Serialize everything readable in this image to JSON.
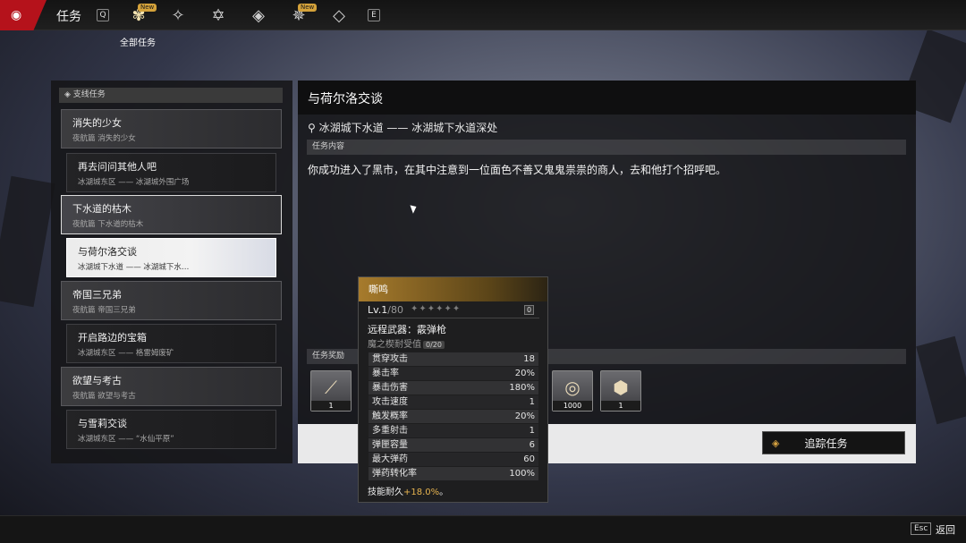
{
  "header": {
    "title": "任务",
    "key_left": "Q",
    "key_right": "E",
    "tab_tooltip": "全部任务",
    "new_badge": "New",
    "tabs": [
      {
        "icon": "all-quests-icon",
        "active": true,
        "new": true
      },
      {
        "icon": "main-quest-icon",
        "active": false,
        "new": false
      },
      {
        "icon": "side-quest-icon",
        "active": false,
        "new": false
      },
      {
        "icon": "commission-icon",
        "active": false,
        "new": false
      },
      {
        "icon": "event-quest-icon",
        "active": false,
        "new": true
      },
      {
        "icon": "daily-quest-icon",
        "active": false,
        "new": false
      }
    ]
  },
  "sidebar": {
    "header": "支线任务",
    "items": [
      {
        "title": "消失的少女",
        "subtitle": "夜航篇 消失的少女"
      },
      {
        "title": "再去问问其他人吧",
        "subtitle": "冰湖城东区 —— 冰湖城外围广场"
      },
      {
        "title": "下水道的枯木",
        "subtitle": "夜航篇 下水道的枯木"
      },
      {
        "title": "与荷尔洛交谈",
        "subtitle": "冰湖城下水道 —— 冰湖城下水…"
      },
      {
        "title": "帝国三兄弟",
        "subtitle": "夜航篇 帝国三兄弟"
      },
      {
        "title": "开启路边的宝箱",
        "subtitle": "冰湖城东区 —— 格雷姆废矿"
      },
      {
        "title": "欲望与考古",
        "subtitle": "夜航篇 欲望与考古"
      },
      {
        "title": "与雪莉交谈",
        "subtitle": "冰湖城东区 —— “水仙平原”"
      }
    ]
  },
  "detail": {
    "title": "与荷尔洛交谈",
    "location": "冰湖城下水道 —— 冰湖城下水道深处",
    "content_header": "任务内容",
    "description": "你成功进入了黑市，在其中注意到一位面色不善又鬼鬼祟祟的商人，去和他打个招呼吧。",
    "rewards_header": "任务奖励",
    "rewards": [
      {
        "icon": "shotgun-icon",
        "count": "1"
      },
      {
        "icon": "coin-icon",
        "count": "1000"
      },
      {
        "icon": "mod-cube-icon",
        "count": "1"
      }
    ],
    "track_button": "追踪任务"
  },
  "tooltip": {
    "name": "嘶鸣",
    "level": "Lv.1",
    "level_max": "/80",
    "stars": "✦✦✦✦✦✦",
    "refine": "0",
    "type": "远程武器：霰弹枪",
    "durability_label": "魔之楔耐受值",
    "durability_value": "0/20",
    "stats": [
      {
        "label": "贯穿攻击",
        "value": "18"
      },
      {
        "label": "暴击率",
        "value": "20%"
      },
      {
        "label": "暴击伤害",
        "value": "180%"
      },
      {
        "label": "攻击速度",
        "value": "1"
      },
      {
        "label": "触发概率",
        "value": "20%"
      },
      {
        "label": "多重射击",
        "value": "1"
      },
      {
        "label": "弹匣容量",
        "value": "6"
      },
      {
        "label": "最大弹药",
        "value": "60"
      },
      {
        "label": "弹药转化率",
        "value": "100%"
      }
    ],
    "skill_text": "技能耐久",
    "skill_value": "+18.0%",
    "skill_tail": "。"
  },
  "footer": {
    "esc_key": "Esc",
    "back_label": "返回"
  },
  "colors": {
    "brand_red": "#b5121b",
    "accent_gold": "#d9a441",
    "selected_item": "#ececec"
  }
}
